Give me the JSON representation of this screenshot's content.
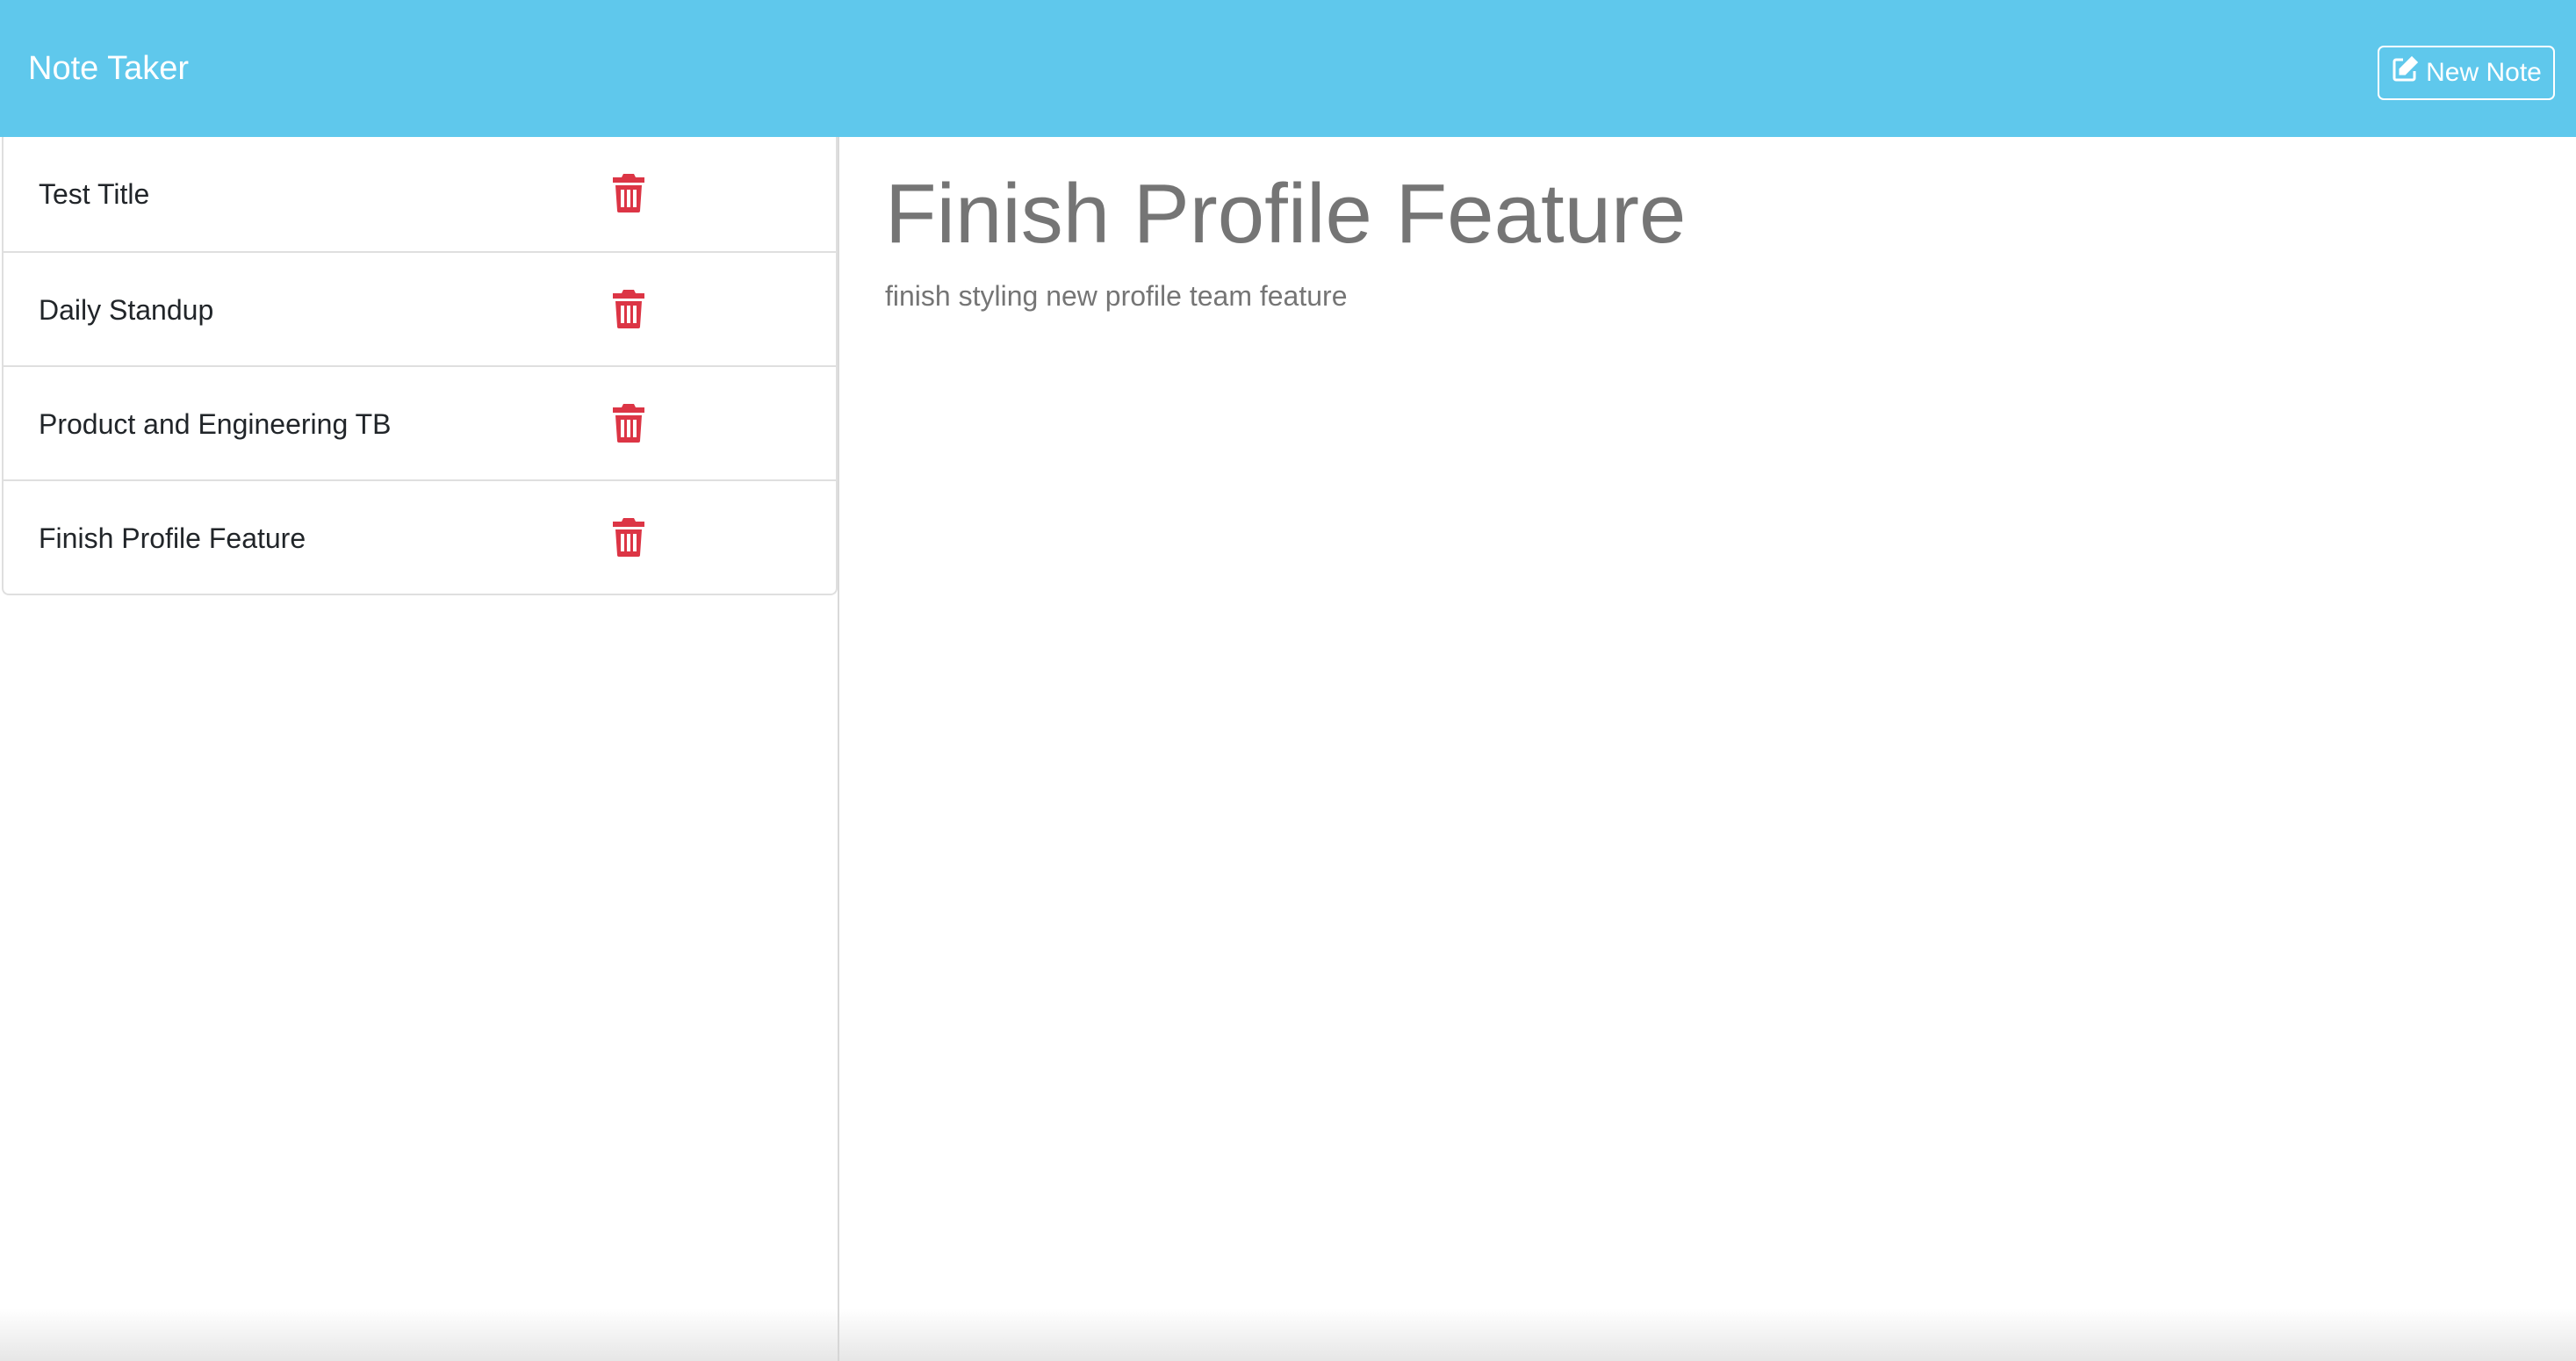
{
  "navbar": {
    "brand": "Note Taker",
    "new_note_label": "New Note",
    "new_note_icon": "edit-icon",
    "background": "#5fc8ec"
  },
  "notes": [
    {
      "title": "Test Title",
      "delete_icon": "trash-icon"
    },
    {
      "title": "Daily Standup",
      "delete_icon": "trash-icon"
    },
    {
      "title": "Product and Engineering TB",
      "delete_icon": "trash-icon"
    },
    {
      "title": "Finish Profile Feature",
      "delete_icon": "trash-icon"
    }
  ],
  "active_note": {
    "title": "Finish Profile Feature",
    "text": "finish styling new profile team feature"
  },
  "colors": {
    "delete": "#dc3545",
    "note_text": "#757575"
  }
}
